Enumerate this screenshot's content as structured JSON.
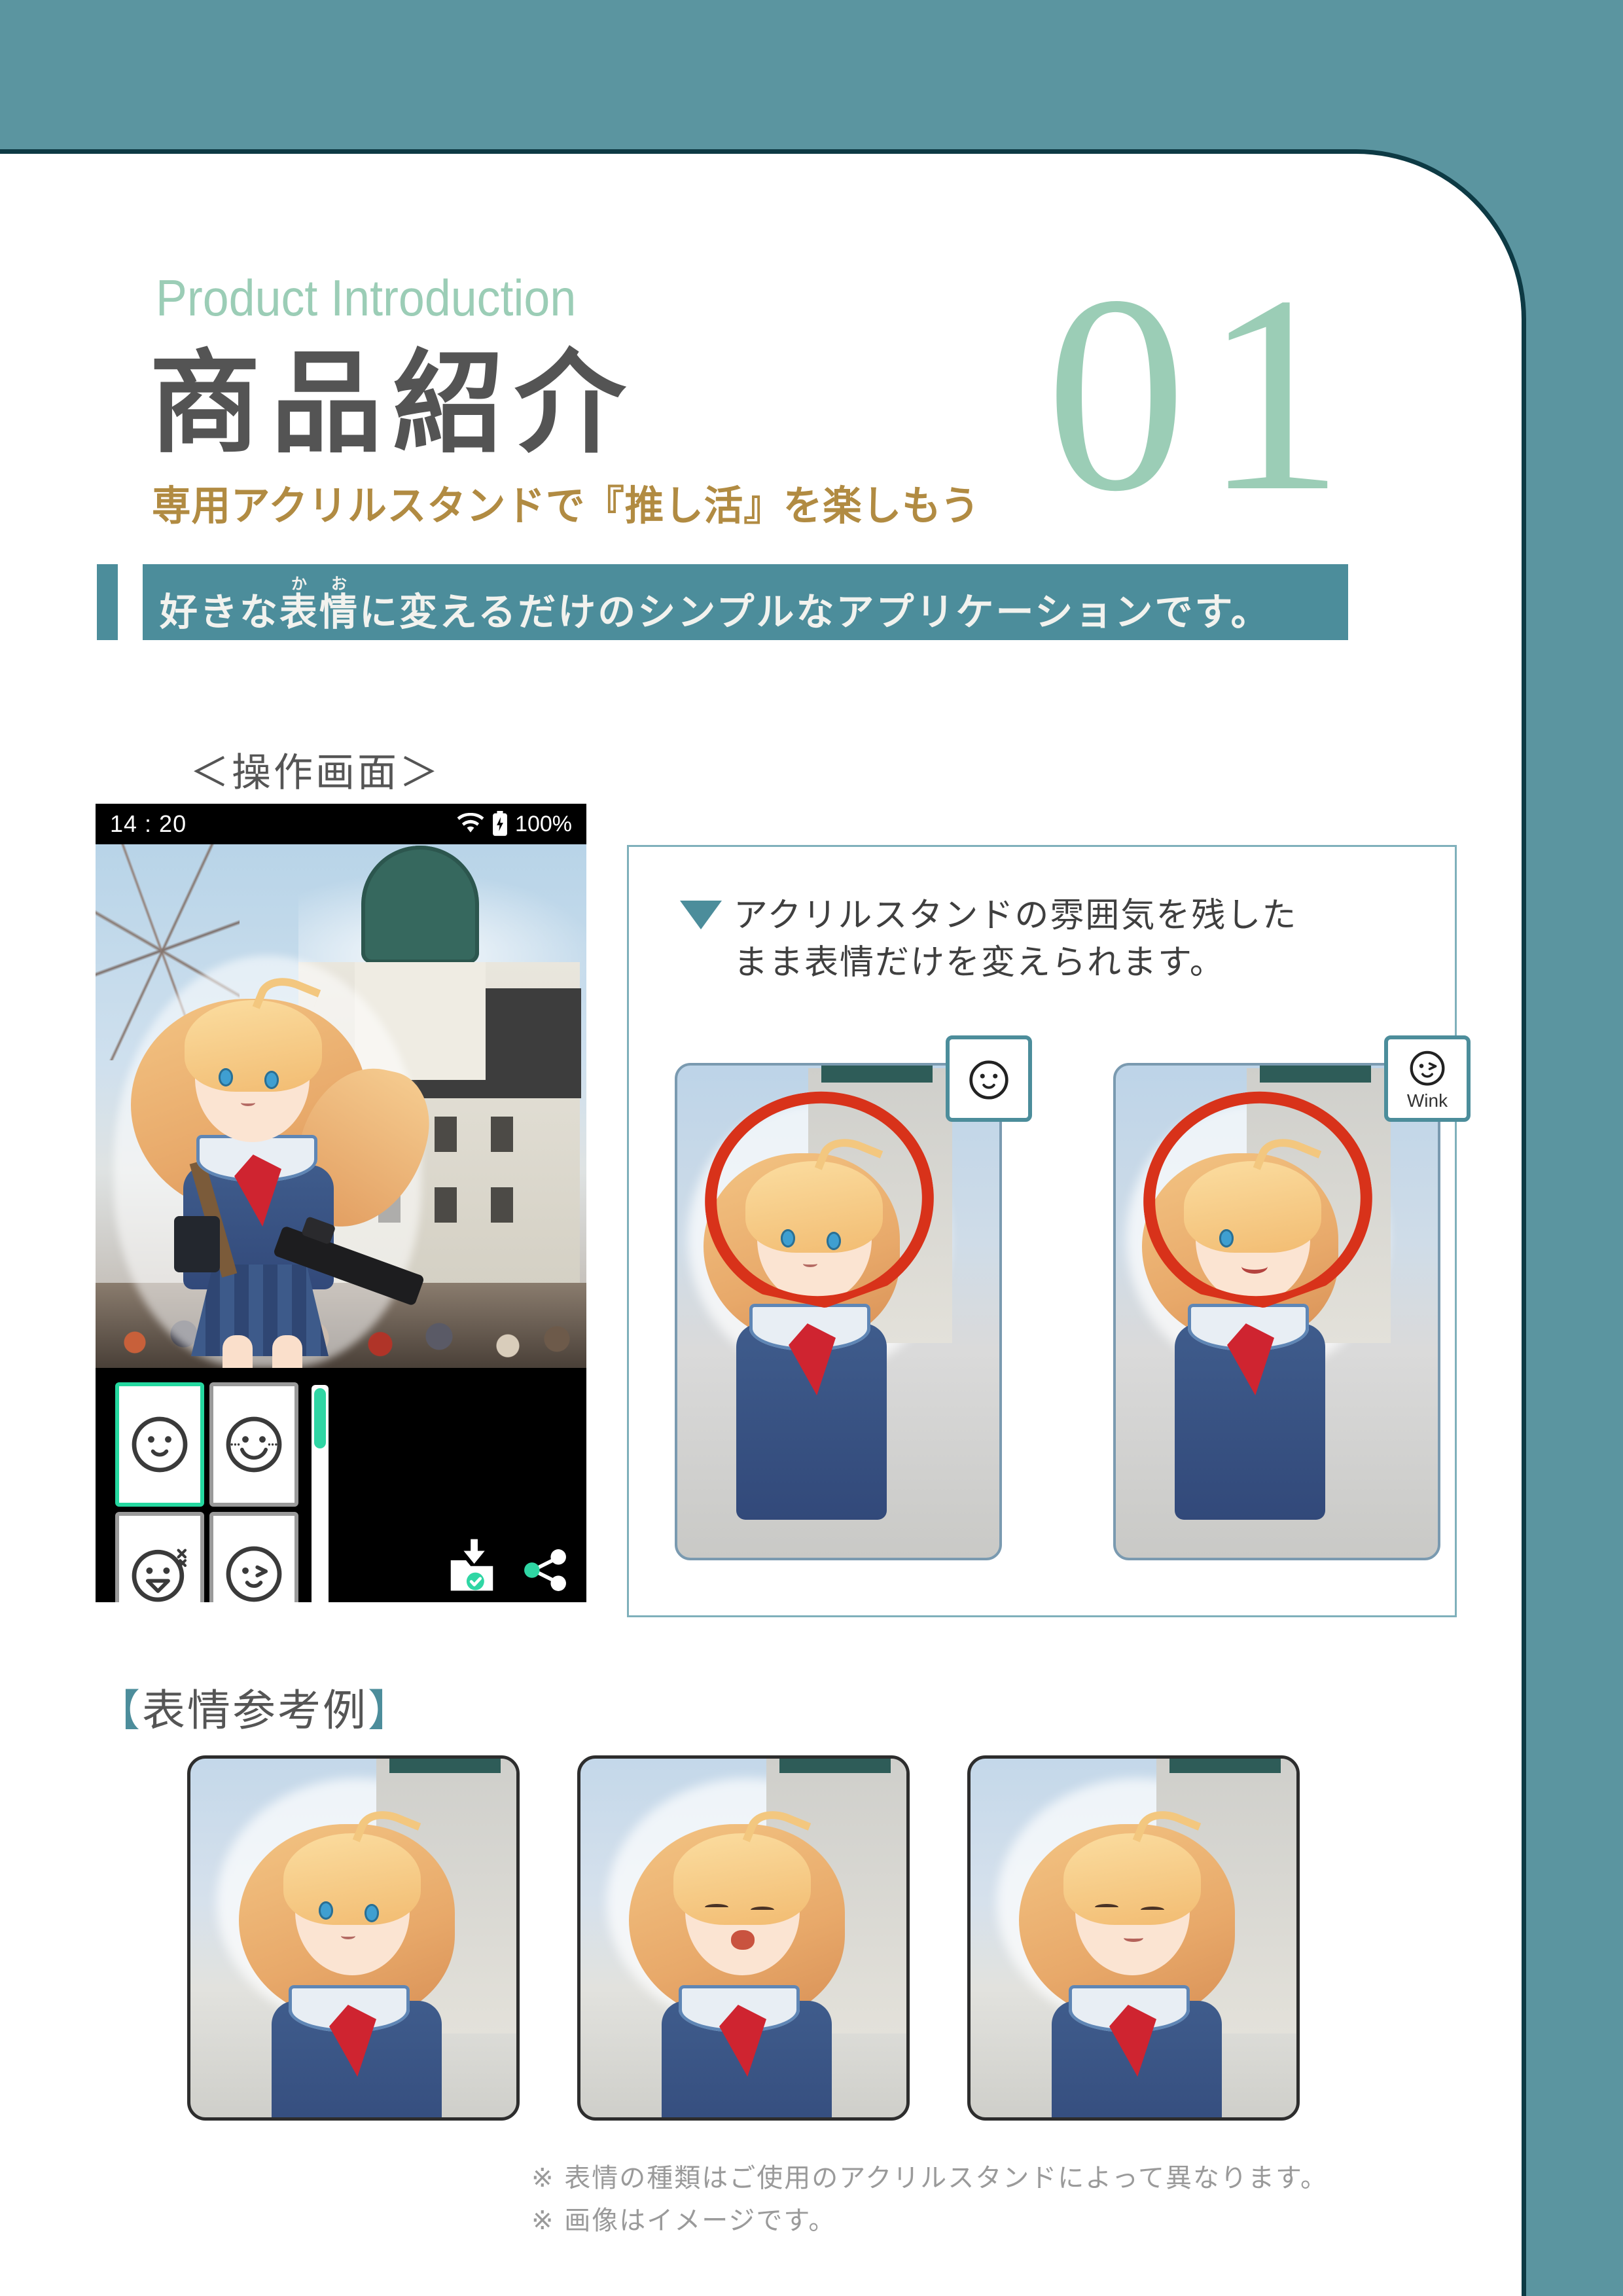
{
  "header": {
    "eyebrow": "Product Introduction",
    "title": "商品紹介",
    "subtitle": "専用アクリルスタンドで『推し活』を楽しもう",
    "number": "01",
    "accent_teal": "#4c8d9b",
    "accent_mint": "#9bcdb6",
    "accent_gold": "#b18b42"
  },
  "banner": {
    "text_before_ruby": "好きな",
    "ruby_base": "表情",
    "ruby_text": "かお",
    "text_after_ruby": "に変えるだけのシンプルなアプリケーションです。",
    "background": "#4c8d9b"
  },
  "operation": {
    "label": "＜操作画面＞",
    "status_bar": {
      "time": "14 : 20",
      "wifi_icon": "wifi-icon",
      "battery_icon": "battery-charging-icon",
      "battery_percent": "100%"
    },
    "toolbar": {
      "faces": [
        {
          "name": "face-smile",
          "selected": true,
          "label": ""
        },
        {
          "name": "face-grin-blush",
          "selected": false,
          "label": ""
        },
        {
          "name": "face-laugh-sweat",
          "selected": false,
          "label": ""
        },
        {
          "name": "face-wink",
          "selected": false,
          "label": ""
        }
      ],
      "scrollbar": "vertical-scrollbar",
      "save_icon": "save-to-folder-icon",
      "share_icon": "share-icon"
    }
  },
  "info_panel": {
    "marker": "▼",
    "line1": "アクリルスタンドの雰囲気を残した",
    "line2": "まま表情だけを変えられます。",
    "comparisons": [
      {
        "badge_icon": "face-smile-icon",
        "badge_label": "",
        "annotation": "red-circle-highlight"
      },
      {
        "badge_icon": "face-wink-icon",
        "badge_label": "Wink",
        "annotation": "red-circle-highlight"
      }
    ]
  },
  "reference": {
    "heading_open": "【",
    "heading_text": "表情参考例",
    "heading_close": "】",
    "items": [
      {
        "name": "expression-soft-smile"
      },
      {
        "name": "expression-open-laugh"
      },
      {
        "name": "expression-closed-eye-smile"
      }
    ]
  },
  "notes": {
    "line1": "※ 表情の種類はご使用のアクリルスタンドによって異なります。",
    "line2": "※ 画像はイメージです。"
  }
}
